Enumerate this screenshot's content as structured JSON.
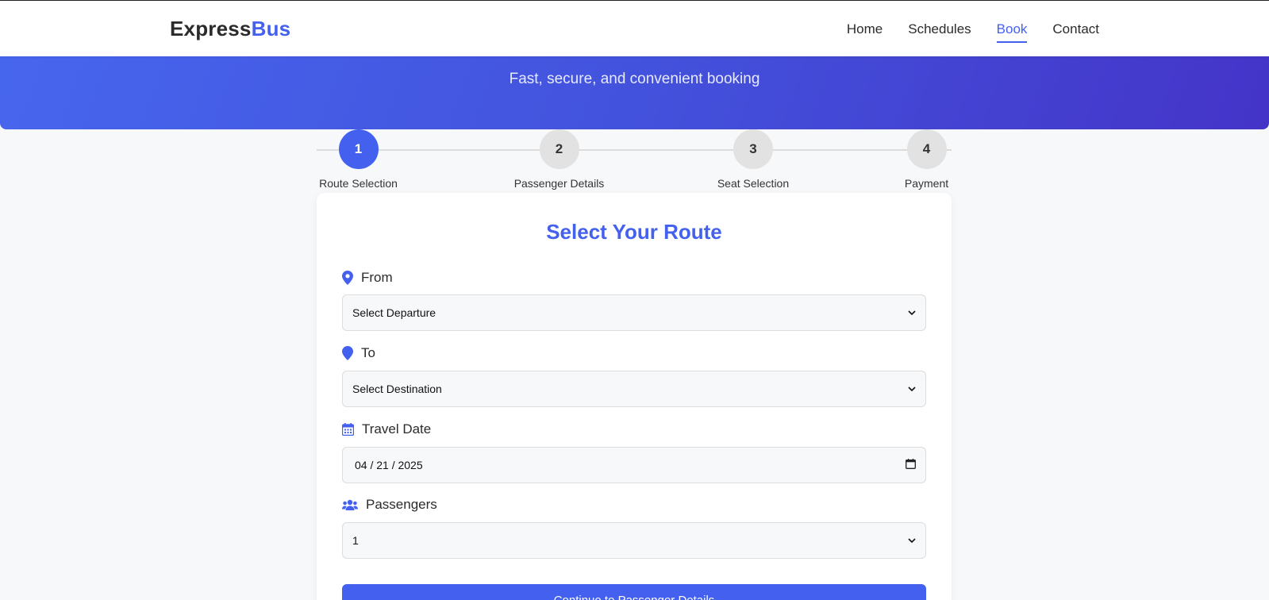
{
  "header": {
    "logo_primary": "Express",
    "logo_accent": "Bus",
    "nav": [
      {
        "label": "Home"
      },
      {
        "label": "Schedules"
      },
      {
        "label": "Book"
      },
      {
        "label": "Contact"
      }
    ],
    "active_nav": "Book"
  },
  "hero": {
    "subtitle": "Fast, secure, and convenient booking"
  },
  "stepper": {
    "steps": [
      {
        "number": "1",
        "label": "Route Selection"
      },
      {
        "number": "2",
        "label": "Passenger Details"
      },
      {
        "number": "3",
        "label": "Seat Selection"
      },
      {
        "number": "4",
        "label": "Payment"
      }
    ],
    "active_step": 1
  },
  "form": {
    "title": "Select Your Route",
    "from": {
      "label": "From",
      "value": "Select Departure",
      "icon": "map-pin-icon"
    },
    "to": {
      "label": "To",
      "value": "Select Destination",
      "icon": "map-pin-icon"
    },
    "date": {
      "label": "Travel Date",
      "value": "04 / 21 / 2025",
      "icon": "calendar-icon"
    },
    "passengers": {
      "label": "Passengers",
      "value": "1",
      "icon": "users-icon"
    },
    "submit_label": "Continue to Passenger Details"
  },
  "colors": {
    "accent": "#4361ee",
    "hero_start": "#4766ee",
    "hero_end": "#4434c8",
    "page_bg": "#f7f8fa"
  }
}
